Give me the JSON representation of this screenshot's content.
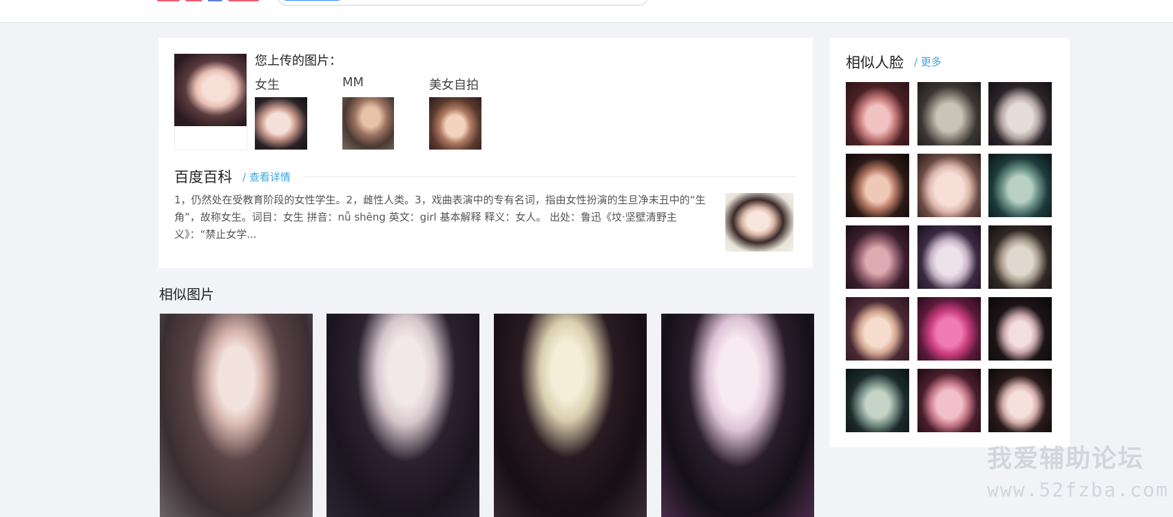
{
  "upload": {
    "title": "您上传的图片：",
    "tags": [
      {
        "label": "女生"
      },
      {
        "label": "MM"
      },
      {
        "label": "美女自拍"
      }
    ]
  },
  "baike": {
    "title": "百度百科",
    "more_link": "/ 查看详情",
    "text": "1，仍然处在受教育阶段的女性学生。2，雌性人类。3，戏曲表演中的专有名词，指由女性扮演的生旦净末丑中的“生角”，故称女生。词目：女生 拼音：nǚ shēng 英文：girl 基本解释 释义：女人。 出处：鲁迅《坟·坚壁清野主义》：“禁止女学..."
  },
  "similar_faces": {
    "title": "相似人脸",
    "more_link": "/ 更多"
  },
  "similar_images": {
    "title": "相似图片"
  },
  "watermark": {
    "title": "我爱辅助论坛",
    "url": "www.52fzba.com"
  }
}
